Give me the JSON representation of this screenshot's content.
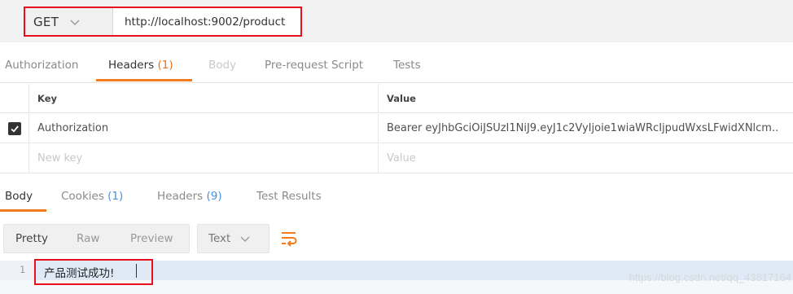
{
  "request": {
    "method": "GET",
    "url": "http://localhost:9002/product"
  },
  "request_tabs": [
    {
      "label": "Authorization",
      "count": ""
    },
    {
      "label": "Headers",
      "count": "(1)"
    },
    {
      "label": "Body",
      "count": ""
    },
    {
      "label": "Pre-request Script",
      "count": ""
    },
    {
      "label": "Tests",
      "count": ""
    }
  ],
  "headers_table": {
    "columns": [
      "Key",
      "Value"
    ],
    "rows": [
      {
        "checked": true,
        "key": "Authorization",
        "value": "Bearer eyJhbGciOiJSUzI1NiJ9.eyJ1c2VyIjoie1wiaWRcIjpudWxsLFwidXNlcm.."
      }
    ],
    "placeholder_key": "New key",
    "placeholder_value": "Value"
  },
  "response_tabs": [
    {
      "label": "Body",
      "count": ""
    },
    {
      "label": "Cookies",
      "count": "(1)"
    },
    {
      "label": "Headers",
      "count": "(9)"
    },
    {
      "label": "Test Results",
      "count": ""
    }
  ],
  "response_toolbar": {
    "view_modes": [
      "Pretty",
      "Raw",
      "Preview"
    ],
    "format": "Text"
  },
  "response_body": {
    "line_number": "1",
    "text": "产品测试成功!"
  },
  "watermark": "https://blog.csdn.net/qq_43817164",
  "icons": {
    "method_caret": "chevron-down-icon",
    "format_caret": "chevron-down-icon",
    "checkbox": "check-icon",
    "wrap": "wrap-lines-icon"
  },
  "colors": {
    "highlight_border": "#e8101d",
    "tab_accent": "#f07c1f",
    "count_orange": "#e8731b",
    "count_blue": "#4a8fe0"
  }
}
